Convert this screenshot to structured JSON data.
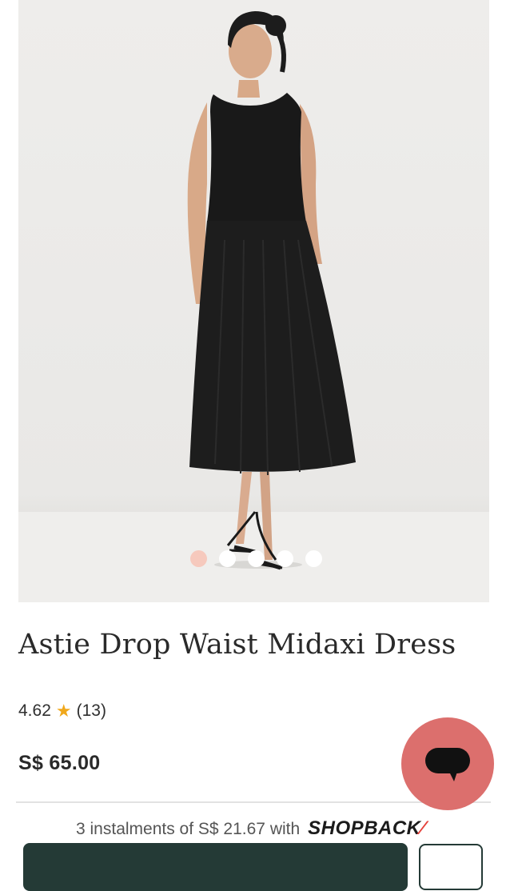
{
  "product": {
    "title": "Astie Drop Waist Midaxi Dress",
    "rating": "4.62",
    "star_glyph": "★",
    "review_count": "(13)",
    "price": "S$ 65.00"
  },
  "gallery": {
    "image_count": 5,
    "active_index": 0,
    "active_dot_color": "#f6c9bd",
    "inactive_dot_color": "#ffffff"
  },
  "promo": {
    "text": "3 instalments of S$ 21.67 with",
    "brand": "SHOPBACK",
    "brand_mark": "⁄"
  },
  "chat": {
    "icon": "chat-bubble-icon",
    "color": "#dc6f6d"
  },
  "actions": {
    "primary_color": "#243a36"
  }
}
